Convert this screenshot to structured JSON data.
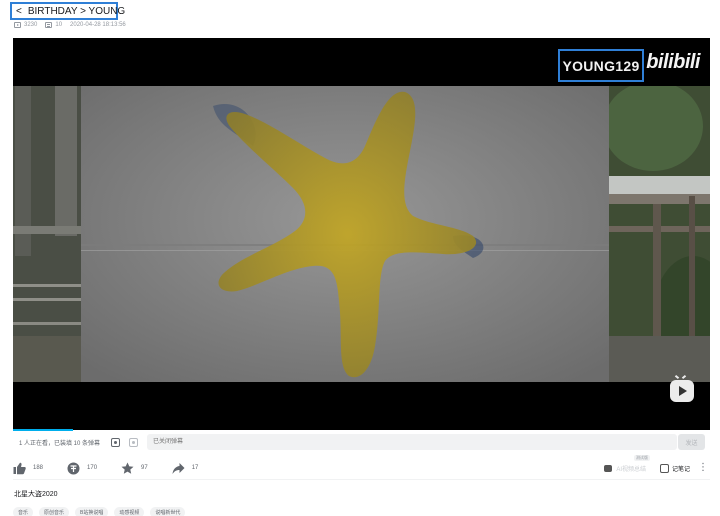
{
  "breadcrumb": {
    "back": "<",
    "path": "BIRTHDAY > YOUNG"
  },
  "meta": {
    "plays": "3230",
    "danmaku": "10",
    "date": "2020-04-28 18:13:56"
  },
  "player": {
    "watermark_box": "YOUNG129",
    "watermark_logo": "bilibili"
  },
  "danmaku_bar": {
    "online": "1 人正在看，已装填 10 条弹幕",
    "input_placeholder": "已关闭弹幕",
    "send": "发送"
  },
  "actions": {
    "like": "188",
    "coin": "170",
    "favorite": "97",
    "share": "17",
    "ai_summary": "AI视频总结",
    "ai_tag": "测试版",
    "notes": "记笔记",
    "more": "⋮"
  },
  "video": {
    "title": "北星大盗2020"
  },
  "tags": [
    "音乐",
    "原创音乐",
    "B站换说唱",
    "动感视频",
    "说唱新世代"
  ]
}
